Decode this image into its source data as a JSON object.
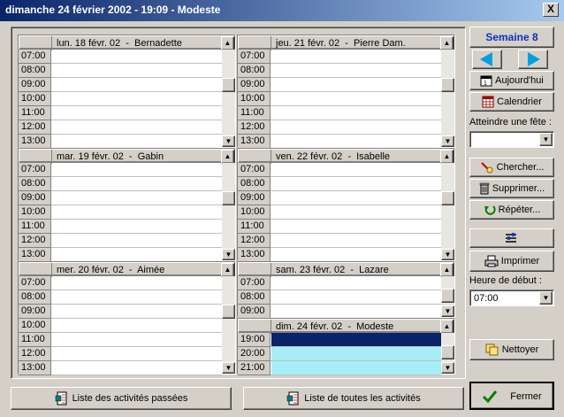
{
  "window": {
    "title": "dimanche 24 février 2002 - 19:09 - Modeste",
    "close_glyph": "X"
  },
  "days": [
    {
      "label": "lun. 18 févr. 02  -  Bernadette",
      "times": [
        "07:00",
        "08:00",
        "09:00",
        "10:00",
        "11:00",
        "12:00",
        "13:00"
      ]
    },
    {
      "label": "mar. 19 févr. 02  -  Gabin",
      "times": [
        "07:00",
        "08:00",
        "09:00",
        "10:00",
        "11:00",
        "12:00",
        "13:00"
      ]
    },
    {
      "label": "mer. 20 févr. 02  -  Aimée",
      "times": [
        "07:00",
        "08:00",
        "09:00",
        "10:00",
        "11:00",
        "12:00",
        "13:00"
      ]
    },
    {
      "label": "jeu. 21 févr. 02  -  Pierre Dam.",
      "times": [
        "07:00",
        "08:00",
        "09:00",
        "10:00",
        "11:00",
        "12:00",
        "13:00"
      ]
    },
    {
      "label": "ven. 22 févr. 02  -  Isabelle",
      "times": [
        "07:00",
        "08:00",
        "09:00",
        "10:00",
        "11:00",
        "12:00",
        "13:00"
      ]
    },
    {
      "label": "sam. 23 févr. 02  -  Lazare",
      "times": [
        "07:00",
        "08:00",
        "09:00"
      ]
    },
    {
      "label": "dim. 24 févr. 02  -  Modeste",
      "times": [
        "19:00",
        "20:00",
        "21:00"
      ]
    }
  ],
  "sidebar": {
    "week_label": "Semaine 8",
    "today_label": "Aujourd'hui",
    "calendar_label": "Calendrier",
    "feast_label": "Atteindre une fête :",
    "feast_value": "",
    "search_label": "Chercher...",
    "delete_label": "Supprimer...",
    "repeat_label": "Répéter...",
    "print_label": "Imprimer",
    "start_hour_label": "Heure de début :",
    "start_hour_value": "07:00",
    "clean_label": "Nettoyer",
    "close_label": "Fermer"
  },
  "bottom": {
    "past_activities_label": "Liste des activités passées",
    "all_activities_label": "Liste de toutes les activités"
  },
  "colors": {
    "accent": "#1030c0",
    "selected_slot": "#0a246a",
    "highlight_slot": "#a6eef8",
    "arrow": "#00a0e0"
  }
}
